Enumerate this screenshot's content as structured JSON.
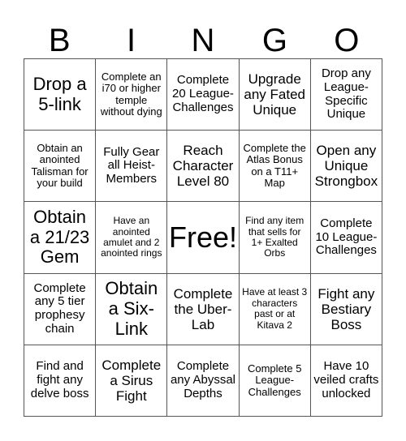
{
  "header": {
    "letters": [
      "B",
      "I",
      "N",
      "G",
      "O"
    ]
  },
  "board": {
    "rows": [
      [
        {
          "text": "Drop a 5-link"
        },
        {
          "text": "Complete an i70 or higher temple without dying"
        },
        {
          "text": "Complete 20 League-Challenges"
        },
        {
          "text": "Upgrade any Fated Unique"
        },
        {
          "text": "Drop any League-Specific Unique"
        }
      ],
      [
        {
          "text": "Obtain an anointed Talisman for your build"
        },
        {
          "text": "Fully Gear all Heist-Members"
        },
        {
          "text": "Reach Character Level 80"
        },
        {
          "text": "Complete the Atlas Bonus on a T11+ Map"
        },
        {
          "text": "Open any Unique Strongbox"
        }
      ],
      [
        {
          "text": "Obtain a 21/23 Gem"
        },
        {
          "text": "Have an anointed amulet and 2 anointed rings"
        },
        {
          "text": "Free!"
        },
        {
          "text": "Find any item that sells for 1+ Exalted Orbs"
        },
        {
          "text": "Complete 10 League-Challenges"
        }
      ],
      [
        {
          "text": "Complete any 5 tier prophesy chain"
        },
        {
          "text": "Obtain a Six-Link"
        },
        {
          "text": "Complete the Uber-Lab"
        },
        {
          "text": "Have at least 3 characters past or at Kitava 2"
        },
        {
          "text": "Fight any Bestiary Boss"
        }
      ],
      [
        {
          "text": "Find and fight any delve boss"
        },
        {
          "text": "Complete a Sirus Fight"
        },
        {
          "text": "Complete any Abyssal Depths"
        },
        {
          "text": "Complete 5 League-Challenges"
        },
        {
          "text": "Have 10 veiled crafts unlocked"
        }
      ]
    ]
  }
}
